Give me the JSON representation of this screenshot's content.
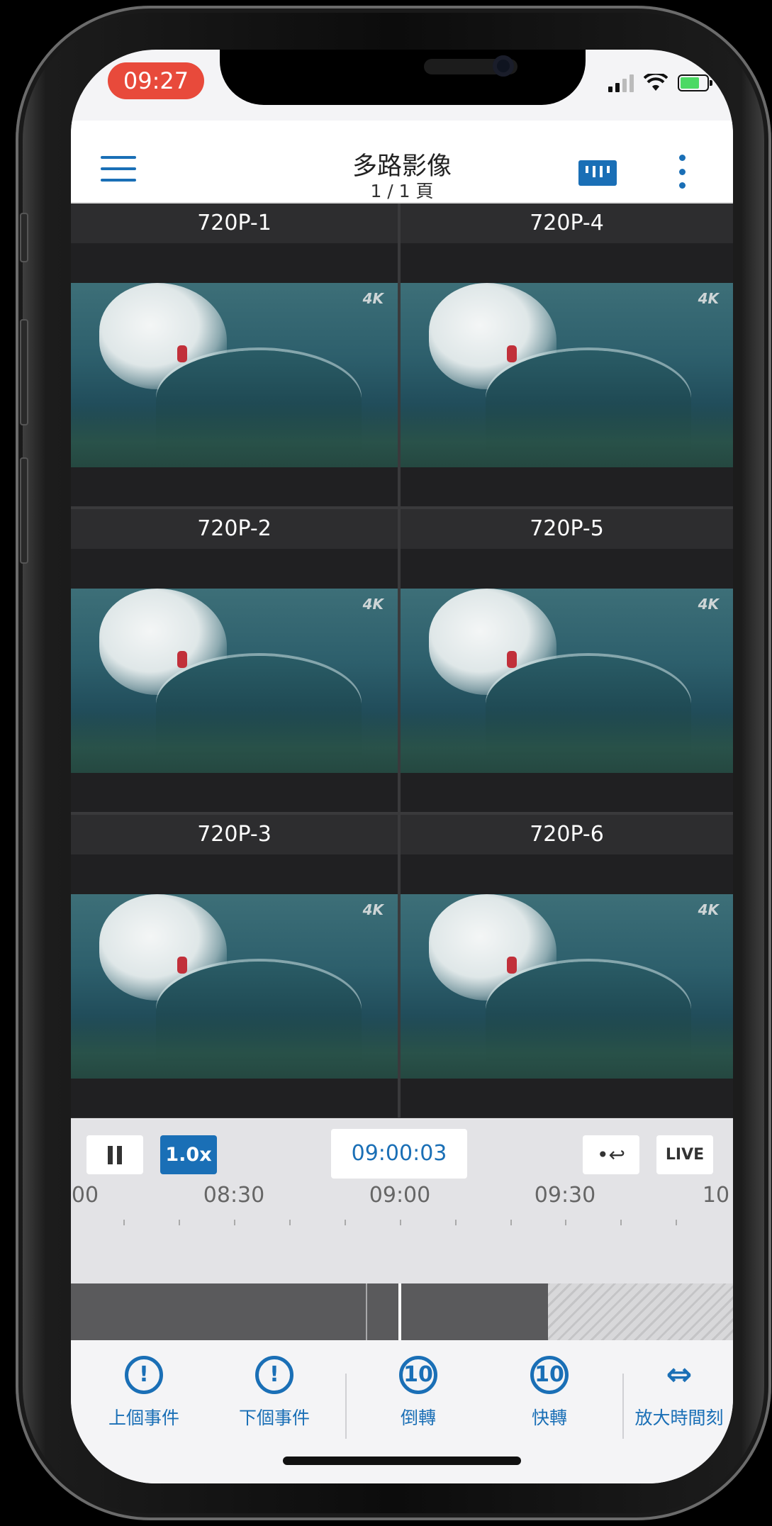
{
  "status_bar": {
    "time": "09:27"
  },
  "header": {
    "title": "多路影像",
    "subtitle": "1 / 1 頁"
  },
  "cameras": [
    {
      "label": "720P-1",
      "badge": "4K"
    },
    {
      "label": "720P-4",
      "badge": "4K"
    },
    {
      "label": "720P-2",
      "badge": "4K"
    },
    {
      "label": "720P-5",
      "badge": "4K"
    },
    {
      "label": "720P-3",
      "badge": "4K"
    },
    {
      "label": "720P-6",
      "badge": "4K"
    }
  ],
  "playback": {
    "speed": "1.0x",
    "current_time": "09:00:03",
    "live_label": "LIVE",
    "timeline_labels": [
      "00",
      "08:30",
      "09:00",
      "09:30",
      "10"
    ]
  },
  "actions": [
    {
      "label": "上個事件",
      "icon": "previous-event-icon"
    },
    {
      "label": "下個事件",
      "icon": "next-event-icon"
    },
    {
      "label": "倒轉",
      "icon": "rewind-10-icon",
      "glyph": "10"
    },
    {
      "label": "快轉",
      "icon": "forward-10-icon",
      "glyph": "10"
    },
    {
      "label": "放大時間刻",
      "icon": "expand-timeline-icon"
    }
  ],
  "colors": {
    "accent": "#1a6fb6",
    "time_pill": "#e84a3b",
    "grid_bg": "#202022"
  }
}
